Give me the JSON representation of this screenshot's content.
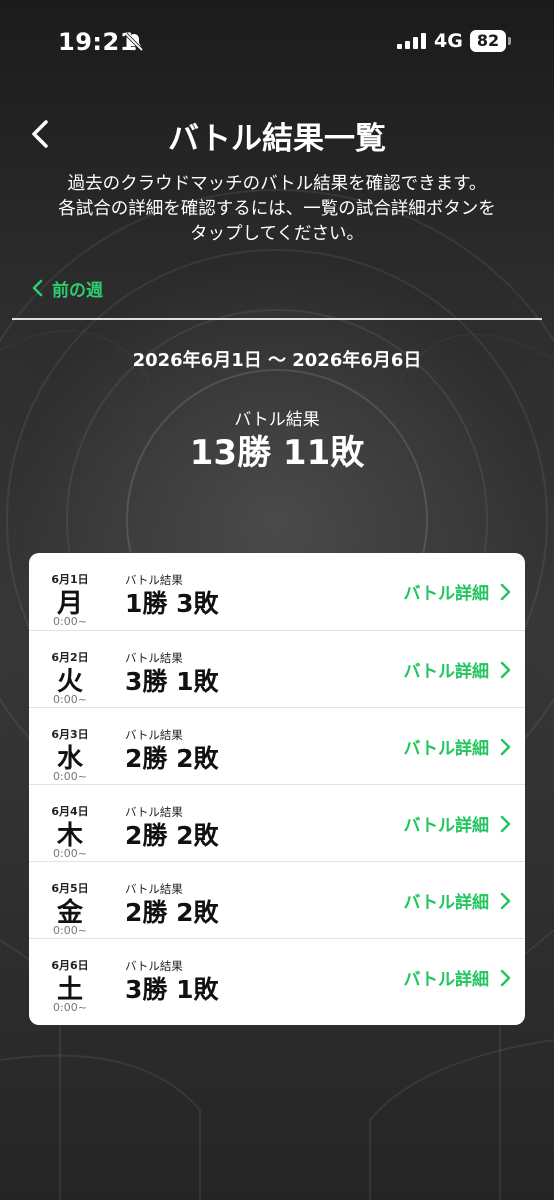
{
  "status_bar": {
    "time": "19:21",
    "network": "4G",
    "battery": "82",
    "icons": [
      "bell-off-icon",
      "signal-icon"
    ]
  },
  "header": {
    "title": "バトル結果一覧",
    "back_icon": "chevron-left-icon",
    "description": [
      "過去のクラウドマッチのバトル結果を確認できます。",
      "各試合の詳細を確認するには、一覧の試合詳細ボタンを",
      "タップしてください。"
    ]
  },
  "navigation": {
    "prev_week_label": "前の週"
  },
  "summary": {
    "date_range": "2026年6月1日 ～ 2026年6月6日",
    "label": "バトル結果",
    "value": "13勝 11敗"
  },
  "results": [
    {
      "date": "6月1日",
      "weekday": "月",
      "time": "0:00~",
      "label": "バトル結果",
      "value": "1勝 3敗",
      "detail_label": "バトル詳細"
    },
    {
      "date": "6月2日",
      "weekday": "火",
      "time": "0:00~",
      "label": "バトル結果",
      "value": "3勝 1敗",
      "detail_label": "バトル詳細"
    },
    {
      "date": "6月3日",
      "weekday": "水",
      "time": "0:00~",
      "label": "バトル結果",
      "value": "2勝 2敗",
      "detail_label": "バトル詳細"
    },
    {
      "date": "6月4日",
      "weekday": "木",
      "time": "0:00~",
      "label": "バトル結果",
      "value": "2勝 2敗",
      "detail_label": "バトル詳細"
    },
    {
      "date": "6月5日",
      "weekday": "金",
      "time": "0:00~",
      "label": "バトル結果",
      "value": "2勝 2敗",
      "detail_label": "バトル詳細"
    },
    {
      "date": "6月6日",
      "weekday": "土",
      "time": "0:00~",
      "label": "バトル結果",
      "value": "3勝 1敗",
      "detail_label": "バトル詳細"
    }
  ],
  "colors": {
    "accent_green": "#22c55e",
    "background": "#2a2a2a",
    "card": "#ffffff"
  }
}
